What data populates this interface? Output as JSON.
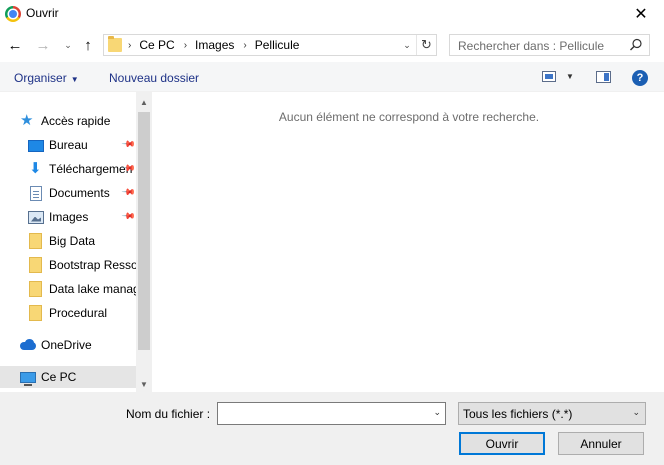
{
  "window": {
    "title": "Ouvrir",
    "close_glyph": "✕"
  },
  "nav": {
    "back_glyph": "←",
    "forward_glyph": "→",
    "recent_glyph": "⌄",
    "up_glyph": "↑"
  },
  "address": {
    "crumbs": [
      "Ce PC",
      "Images",
      "Pellicule"
    ],
    "separator": "›",
    "dropdown_glyph": "⌄",
    "refresh_glyph": "↻"
  },
  "search": {
    "placeholder": "Rechercher dans : Pellicule"
  },
  "toolbar": {
    "organiser_label": "Organiser",
    "organiser_caret": "▼",
    "new_folder_label": "Nouveau dossier",
    "view_caret": "▼",
    "help_label": "?"
  },
  "sidebar": {
    "pin_glyph": "📌",
    "items": [
      {
        "label": "Accès rapide",
        "icon": "star-icon"
      },
      {
        "label": "Bureau",
        "icon": "desktop-icon",
        "pinned": true
      },
      {
        "label": "Téléchargements",
        "icon": "download-icon",
        "pinned": true
      },
      {
        "label": "Documents",
        "icon": "document-icon",
        "pinned": true
      },
      {
        "label": "Images",
        "icon": "images-icon",
        "pinned": true
      },
      {
        "label": "Big Data",
        "icon": "folder-icon"
      },
      {
        "label": "Bootstrap Ressources",
        "icon": "folder-icon"
      },
      {
        "label": "Data lake management",
        "icon": "folder-icon"
      },
      {
        "label": "Procedural",
        "icon": "folder-icon"
      },
      {
        "label": "OneDrive",
        "icon": "cloud-icon"
      },
      {
        "label": "Ce PC",
        "icon": "computer-icon",
        "selected": true
      }
    ],
    "scroll_up_glyph": "▲",
    "scroll_down_glyph": "▼"
  },
  "content": {
    "empty_message": "Aucun élément ne correspond à votre recherche."
  },
  "footer": {
    "filename_label": "Nom du fichier :",
    "filename_value": "",
    "filename_caret": "⌄",
    "filter_value": "Tous les fichiers (*.*)",
    "filter_caret": "⌄",
    "open_label": "Ouvrir",
    "cancel_label": "Annuler"
  },
  "colors": {
    "toolbar_text": "#1e3287",
    "selected_bg": "#e5e5e5",
    "footer_bg": "#f0f0f0",
    "primary_border": "#0078d7"
  }
}
